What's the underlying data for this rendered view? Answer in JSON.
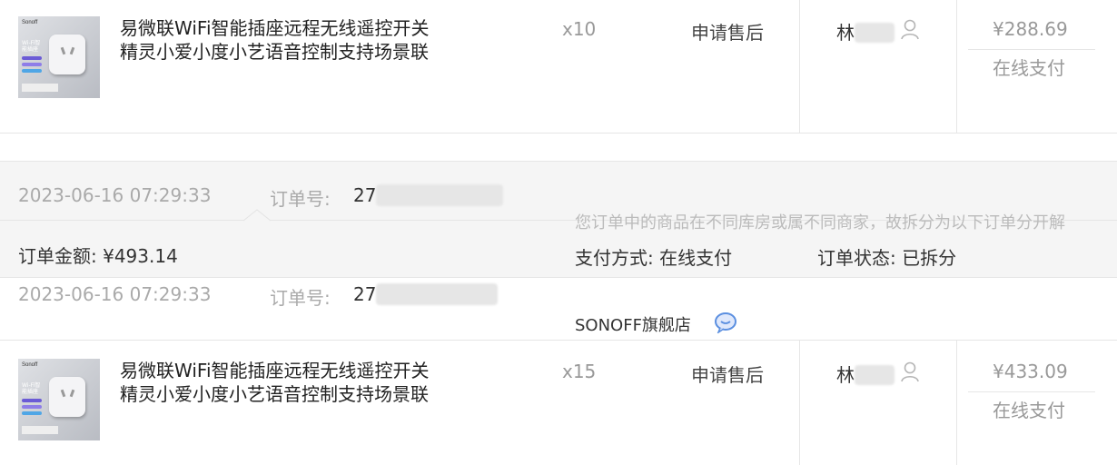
{
  "order1": {
    "product": {
      "thumb_brand": "Sonoff",
      "thumb_title": "Wi-Fi智能插座",
      "name_line1": "易微联WiFi智能插座远程无线遥控开关",
      "name_line2": "精灵小爱小度小艺语音控制支持场景联"
    },
    "qty": "x10",
    "after_sale": "申请售后",
    "recipient": "林",
    "price": "¥288.69",
    "pay_method": "在线支付"
  },
  "parent_order": {
    "datetime": "2023-06-16 07:29:33",
    "order_no_label": "订单号:",
    "order_no_visible": "27",
    "amount_text": "订单金额: ¥493.14",
    "tip": "您订单中的商品在不同库房或属不同商家，故拆分为以下订单分开解",
    "pay_text": "支付方式: 在线支付",
    "status_text": "订单状态: 已拆分"
  },
  "suborder": {
    "datetime": "2023-06-16 07:29:33",
    "order_no_label": "订单号:",
    "order_no_visible": "27",
    "shop_name": "SONOFF旗舰店",
    "chat_icon": "chat-bubble-icon"
  },
  "order2": {
    "product": {
      "thumb_brand": "Sonoff",
      "thumb_title": "Wi-Fi智能插座",
      "name_line1": "易微联WiFi智能插座远程无线遥控开关",
      "name_line2": "精灵小爱小度小艺语音控制支持场景联"
    },
    "qty": "x15",
    "after_sale": "申请售后",
    "recipient": "林",
    "price": "¥433.09",
    "pay_method": "在线支付"
  },
  "colors": {
    "accent_blue": "#5b8fe0",
    "grey_text": "#999999",
    "divider": "#e6e6e6",
    "panel": "#f5f5f5"
  }
}
